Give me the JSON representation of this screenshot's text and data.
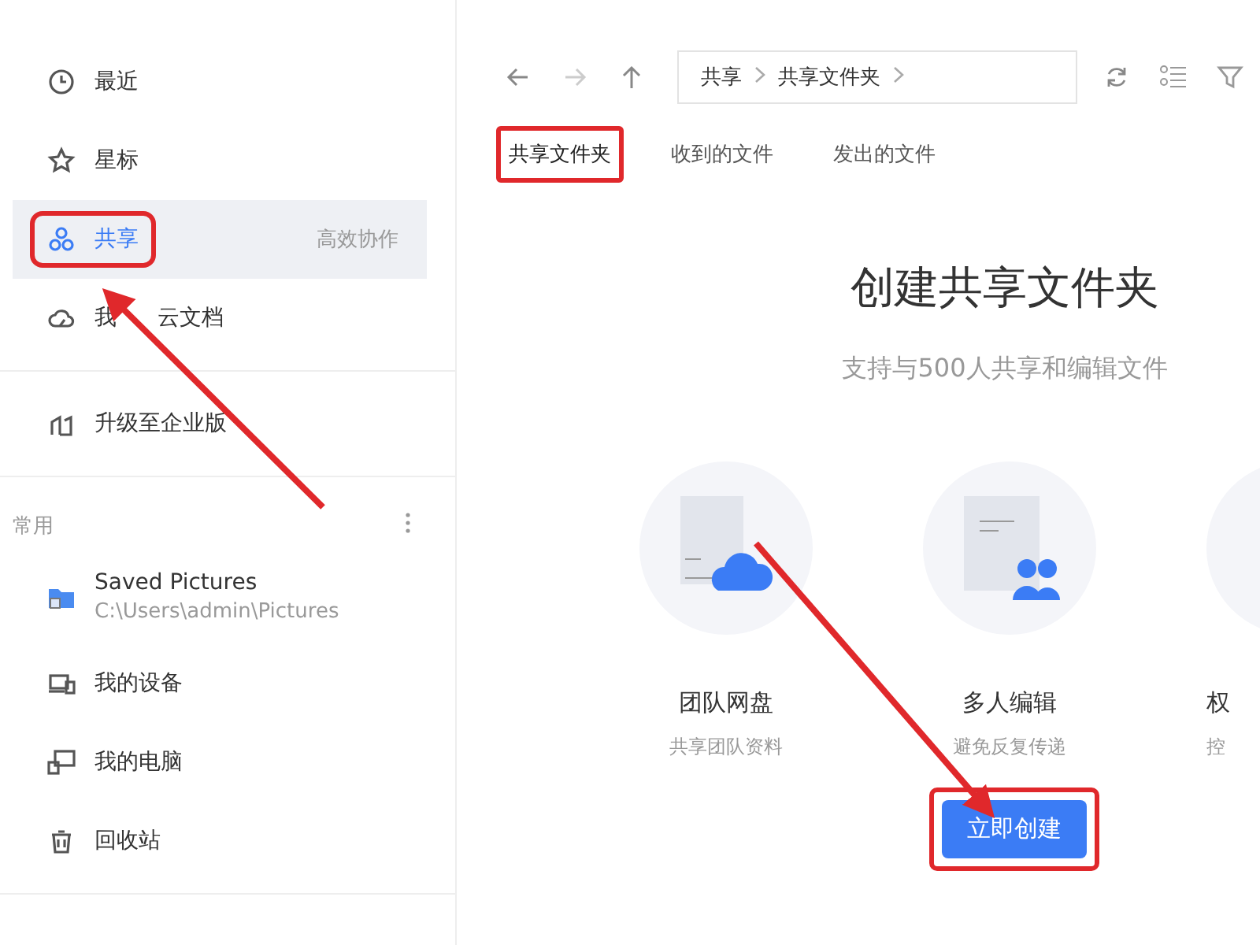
{
  "sidebar": {
    "groups": [
      {
        "items": [
          {
            "label": "最近",
            "selected": false,
            "highlighted": false
          },
          {
            "label": "星标",
            "selected": false,
            "highlighted": false
          },
          {
            "label": "共享",
            "note": "高效协作",
            "selected": true,
            "highlighted": true
          },
          {
            "label_parts": [
              "我",
              "云文档"
            ],
            "selected": false,
            "highlighted": false
          }
        ]
      },
      {
        "items": [
          {
            "label": "升级至企业版",
            "selected": false,
            "highlighted": false
          }
        ]
      },
      {
        "heading": "常用",
        "items": [
          {
            "label": "Saved Pictures",
            "path": "C:\\Users\\admin\\Pictures",
            "selected": false,
            "highlighted": false
          },
          {
            "label": "我的设备",
            "selected": false,
            "highlighted": false
          },
          {
            "label": "我的电脑",
            "selected": false,
            "highlighted": false
          },
          {
            "label": "回收站",
            "selected": false,
            "highlighted": false
          }
        ]
      }
    ]
  },
  "toolbar": {
    "breadcrumb": [
      "共享",
      "共享文件夹"
    ]
  },
  "tabs": [
    {
      "label": "共享文件夹",
      "selected": true,
      "highlighted": true
    },
    {
      "label": "收到的文件",
      "selected": false,
      "highlighted": false
    },
    {
      "label": "发出的文件",
      "selected": false,
      "highlighted": false
    }
  ],
  "hero": {
    "title": "创建共享文件夹",
    "subtitle": "支持与500人共享和编辑文件"
  },
  "features": [
    {
      "title": "团队网盘",
      "subtitle": "共享团队资料"
    },
    {
      "title": "多人编辑",
      "subtitle": "避免反复传递"
    },
    {
      "title": "权",
      "subtitle": "控"
    }
  ],
  "create_button": {
    "label": "立即创建",
    "highlighted": true
  }
}
